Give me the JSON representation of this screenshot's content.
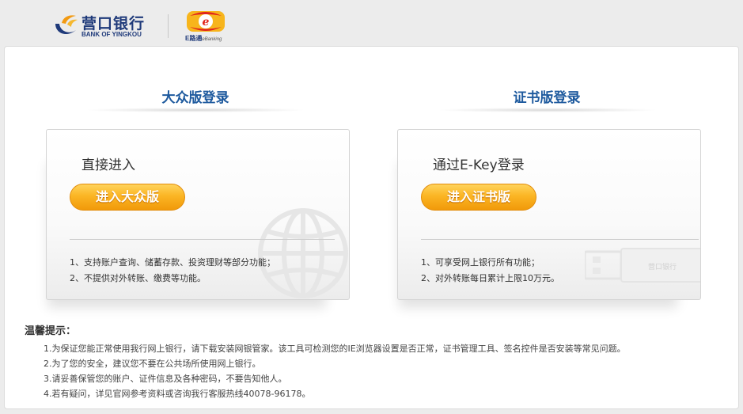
{
  "header": {
    "bank_name_cn": "营口银行",
    "bank_name_en": "BANK OF YINGKOU",
    "ebank_name": "E路通",
    "ebank_sub": "eBanking"
  },
  "public": {
    "title": "大众版登录",
    "heading": "直接进入",
    "button": "进入大众版",
    "features": [
      "1、支持账户查询、储蓄存款、投资理财等部分功能；",
      "2、不提供对外转账、缴费等功能。"
    ]
  },
  "cert": {
    "title": "证书版登录",
    "heading": "通过E-Key登录",
    "button": "进入证书版",
    "features": [
      "1、可享受网上银行所有功能；",
      "2、对外转账每日累计上限10万元。"
    ],
    "usb_label": "营口银行"
  },
  "tips": {
    "title": "温馨提示：",
    "items": [
      "1.为保证您能正常使用我行网上银行，请下载安装网银管家。该工具可检测您的IE浏览器设置是否正常，证书管理工具、签名控件是否安装等常见问题。",
      "2.为了您的安全，建议您不要在公共场所使用网上银行。",
      "3.请妥善保管您的账户、证件信息及各种密码，不要告知他人。",
      "4.若有疑问，详见官网参考资料或咨询我行客服热线40078-96178。"
    ]
  },
  "colors": {
    "title_blue": "#1e5a9e",
    "brand_navy": "#1f3a7a",
    "button_orange": "#f6a717"
  }
}
